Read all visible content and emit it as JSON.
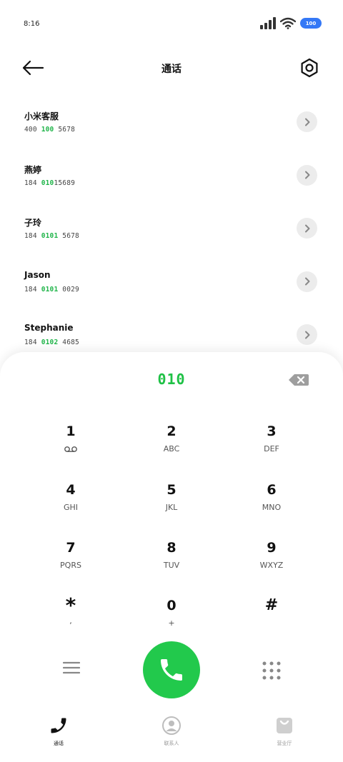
{
  "status_bar": {
    "time": "8:16",
    "battery": "100"
  },
  "header": {
    "title": "通话"
  },
  "contacts": [
    {
      "name": "小米客服",
      "number_parts": [
        {
          "t": "400 ",
          "hl": false
        },
        {
          "t": "100",
          "hl": true
        },
        {
          "t": " 5678",
          "hl": false
        }
      ]
    },
    {
      "name": "燕婷",
      "number_parts": [
        {
          "t": "184 ",
          "hl": false
        },
        {
          "t": "010",
          "hl": true
        },
        {
          "t": "15689",
          "hl": false
        }
      ]
    },
    {
      "name": "子玲",
      "number_parts": [
        {
          "t": "184 ",
          "hl": false
        },
        {
          "t": "0101",
          "hl": true
        },
        {
          "t": " 5678",
          "hl": false
        }
      ]
    },
    {
      "name": "Jason",
      "number_parts": [
        {
          "t": "184 ",
          "hl": false
        },
        {
          "t": "0101",
          "hl": true
        },
        {
          "t": " 0029",
          "hl": false
        }
      ]
    },
    {
      "name": "Stephanie",
      "number_parts": [
        {
          "t": "184 ",
          "hl": false
        },
        {
          "t": "0102",
          "hl": true
        },
        {
          "t": " 4685",
          "hl": false
        }
      ]
    }
  ],
  "dialpad": {
    "input": "010",
    "keys": [
      {
        "digit": "1",
        "letters": "",
        "icon": "voicemail-icon"
      },
      {
        "digit": "2",
        "letters": "ABC"
      },
      {
        "digit": "3",
        "letters": "DEF"
      },
      {
        "digit": "4",
        "letters": "GHI"
      },
      {
        "digit": "5",
        "letters": "JKL"
      },
      {
        "digit": "6",
        "letters": "MNO"
      },
      {
        "digit": "7",
        "letters": "PQRS"
      },
      {
        "digit": "8",
        "letters": "TUV"
      },
      {
        "digit": "9",
        "letters": "WXYZ"
      },
      {
        "digit": "*",
        "letters": ","
      },
      {
        "digit": "0",
        "letters": "+"
      },
      {
        "digit": "#",
        "letters": ""
      }
    ]
  },
  "nav": {
    "calls": "通话",
    "contacts": "联系人",
    "store": "营业厅"
  },
  "colors": {
    "accent_green": "#22c94c",
    "highlight_green": "#20b54a",
    "battery_blue": "#3478f6"
  }
}
